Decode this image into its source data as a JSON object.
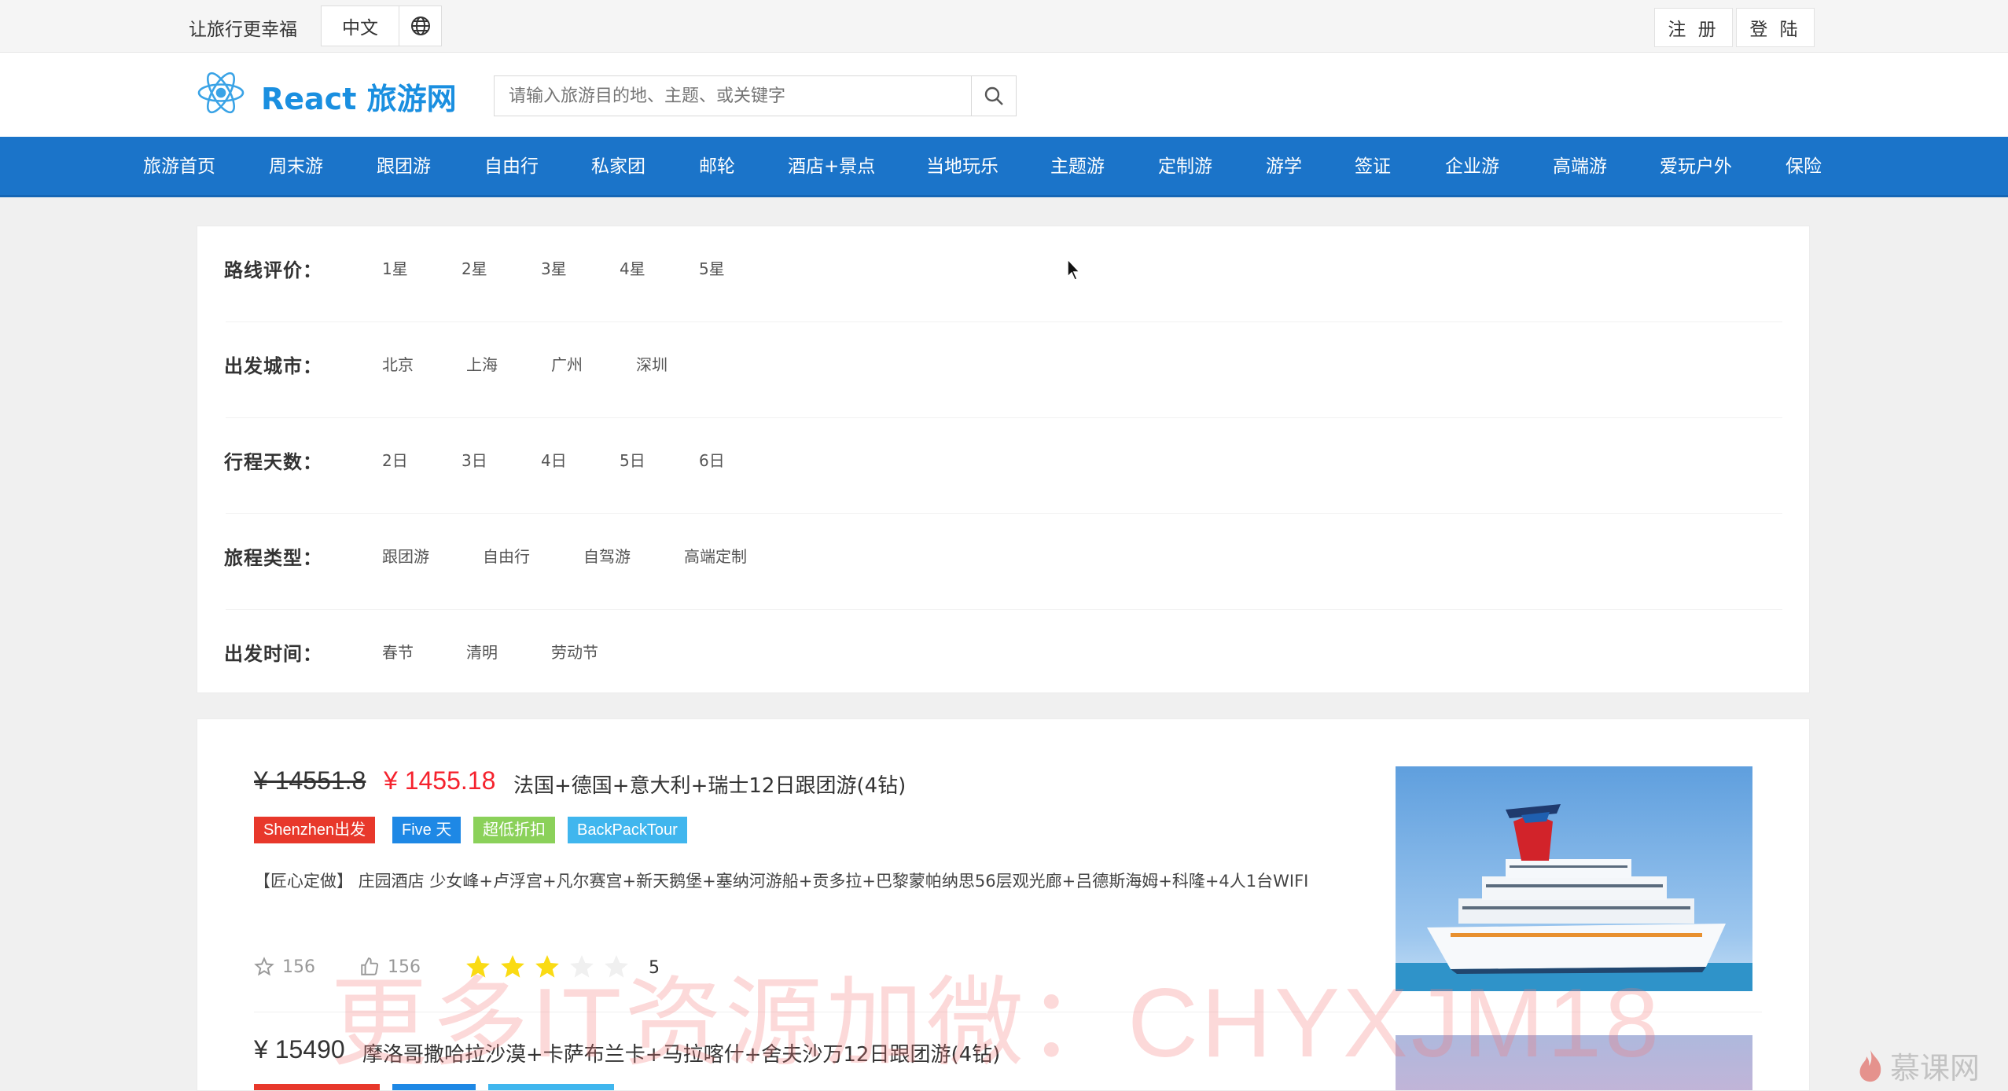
{
  "topbar": {
    "slogan": "让旅行更幸福",
    "language": "中文",
    "register": "注 册",
    "login": "登 陆"
  },
  "header": {
    "title": "React 旅游网",
    "search_placeholder": "请输入旅游目的地、主题、或关键字"
  },
  "nav": {
    "items": [
      "旅游首页",
      "周末游",
      "跟团游",
      "自由行",
      "私家团",
      "邮轮",
      "酒店+景点",
      "当地玩乐",
      "主题游",
      "定制游",
      "游学",
      "签证",
      "企业游",
      "高端游",
      "爱玩户外",
      "保险"
    ]
  },
  "filters": [
    {
      "label": "路线评价：",
      "options": [
        "1星",
        "2星",
        "3星",
        "4星",
        "5星"
      ]
    },
    {
      "label": "出发城市：",
      "options": [
        "北京",
        "上海",
        "广州",
        "深圳"
      ]
    },
    {
      "label": "行程天数：",
      "options": [
        "2日",
        "3日",
        "4日",
        "5日",
        "6日"
      ]
    },
    {
      "label": "旅程类型：",
      "options": [
        "跟团游",
        "自由行",
        "自驾游",
        "高端定制"
      ]
    },
    {
      "label": "出发时间：",
      "options": [
        "春节",
        "清明",
        "劳动节"
      ]
    }
  ],
  "products": [
    {
      "original_price": "¥ 14551.8",
      "price": "¥ 1455.18",
      "title": "法国+德国+意大利+瑞士12日跟团游(4钻)",
      "tags": [
        {
          "label": "Shenzhen出发",
          "color": "#e8382b"
        },
        {
          "label": "Five 天",
          "color": "#1e88e5"
        },
        {
          "label": "超低折扣",
          "color": "#8bd15a"
        },
        {
          "label": "BackPackTour",
          "color": "#40b6ee"
        }
      ],
      "description": "【匠心定做】 庄园酒店 少女峰+卢浮宫+凡尔赛宫+新天鹅堡+塞纳河游船+贡多拉+巴黎蒙帕纳思56层观光廊+吕德斯海姆+科隆+4人1台WIFI",
      "favorites": "156",
      "likes": "156",
      "rating": 3,
      "rating_max": 5,
      "rating_text": "5"
    },
    {
      "price": "¥ 15490",
      "title": "摩洛哥撒哈拉沙漠+卡萨布兰卡+马拉喀什+舍夫沙万12日跟团游(4钻)"
    }
  ],
  "watermark": "更多IT资源加微：CHYXJM18",
  "brand_mark": "慕课网",
  "colors": {
    "nav_bg": "#1b74c9",
    "brand_blue": "#1a8fe0",
    "discount_red": "#f5222d",
    "star_gold": "#fadb14"
  }
}
